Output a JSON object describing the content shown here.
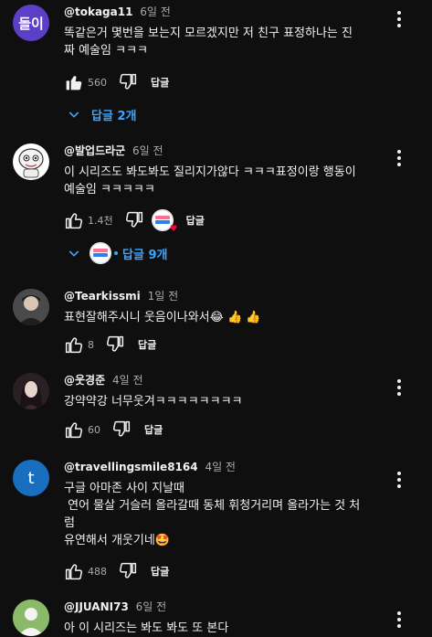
{
  "icons": {
    "like": "thumbs-up-icon",
    "dislike": "thumbs-down-icon",
    "more": "more-vert-icon",
    "chevron": "chevron-down-icon"
  },
  "colors": {
    "background": "#0f0f0f",
    "link": "#3ea6ff",
    "muted": "#aaaaaa"
  },
  "comments": [
    {
      "author": "@tokaga11",
      "time": "6일 전",
      "avatar_text": "돌이",
      "avatar_color": "#5c3fc7",
      "lines": [
        "똑같은거 몇번을 보는지 모르겠지만 저 친구 표정하나는 진",
        "짜 예술임 ㅋㅋㅋ"
      ],
      "likes": "560",
      "reply_label": "답글",
      "replies_label": "답글 2개"
    },
    {
      "author": "@발업드라군",
      "time": "6일 전",
      "avatar_text": "",
      "avatar_color": "#ffffff",
      "lines": [
        "이 시리즈도 봐도봐도 질리지가않다 ㅋㅋㅋ표정이랑 행동이",
        "예술임 ㅋㅋㅋㅋㅋ"
      ],
      "likes": "1.4천",
      "reply_label": "답글",
      "replies_label": "답글 9개"
    },
    {
      "author": "@Tearkissmi",
      "time": "1일 전",
      "avatar_text": "",
      "avatar_color": "#3a3a3a",
      "lines": [
        "표현잘해주시니 웃음이나와서"
      ],
      "emojis": "😂 👍 👍",
      "likes": "8",
      "reply_label": "답글"
    },
    {
      "author": "@웃경준",
      "time": "4일 전",
      "avatar_text": "",
      "avatar_color": "#2a2024",
      "lines": [
        "강약약강 너무웃겨ㅋㅋㅋㅋㅋㅋㅋㅋ"
      ],
      "likes": "60",
      "reply_label": "답글"
    },
    {
      "author": "@travellingsmile8164",
      "time": "4일 전",
      "avatar_text": "t",
      "avatar_color": "#1a6ec0",
      "lines": [
        "구글 아마존 사이 지날때",
        " 연어 물살 거슬러 올라갈때 동체 휘청거리며 올라가는 것 처",
        "럼",
        "유연해서 개웃기네"
      ],
      "emojis": "🤩",
      "likes": "488",
      "reply_label": "답글"
    },
    {
      "author": "@JJUANI73",
      "time": "6일 전",
      "avatar_text": "",
      "avatar_color": "#8ab96a",
      "lines": [
        "아 이 시리즈는 봐도 봐도 또 본다"
      ]
    }
  ]
}
